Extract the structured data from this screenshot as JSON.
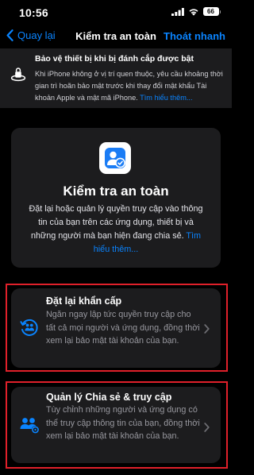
{
  "status_bar": {
    "time": "10:56",
    "battery": "66"
  },
  "nav": {
    "back_label": "Quay lại",
    "title": "Kiểm tra an toàn",
    "quick_exit_label": "Thoát nhanh"
  },
  "banner": {
    "title": "Bảo vệ thiết bị khi bị đánh cắp được bật",
    "body": "Khi iPhone không ở vị trí quen thuộc, yêu cầu khoảng thời gian trì hoãn bảo mật trước khi thay đổi mật khẩu Tài khoản Apple và mật mã iPhone.",
    "link": "Tìm hiểu thêm..."
  },
  "intro": {
    "title": "Kiểm tra an toàn",
    "body": "Đặt lại hoặc quản lý quyền truy cập vào thông tin của bạn trên các ứng dụng, thiết bị và những người mà bạn hiện đang chia sẻ.",
    "link": "Tìm hiểu thêm..."
  },
  "actions": [
    {
      "title": "Đặt lại khẩn cấp",
      "body": "Ngăn ngay lập tức quyền truy cập cho tất cả mọi người và ứng dụng, đồng thời xem lại bảo mật tài khoản của bạn.",
      "icon": "emergency-reset-icon"
    },
    {
      "title": "Quản lý Chia sẻ & truy cập",
      "body": "Tùy chỉnh những người và ứng dụng có thể truy cập thông tin của bạn, đồng thời xem lại bảo mật tài khoản của bạn.",
      "icon": "people-manage-icon"
    }
  ],
  "colors": {
    "accent": "#0a84ff",
    "card": "#1c1c1e",
    "background": "#000000",
    "highlight": "#e0202a"
  }
}
